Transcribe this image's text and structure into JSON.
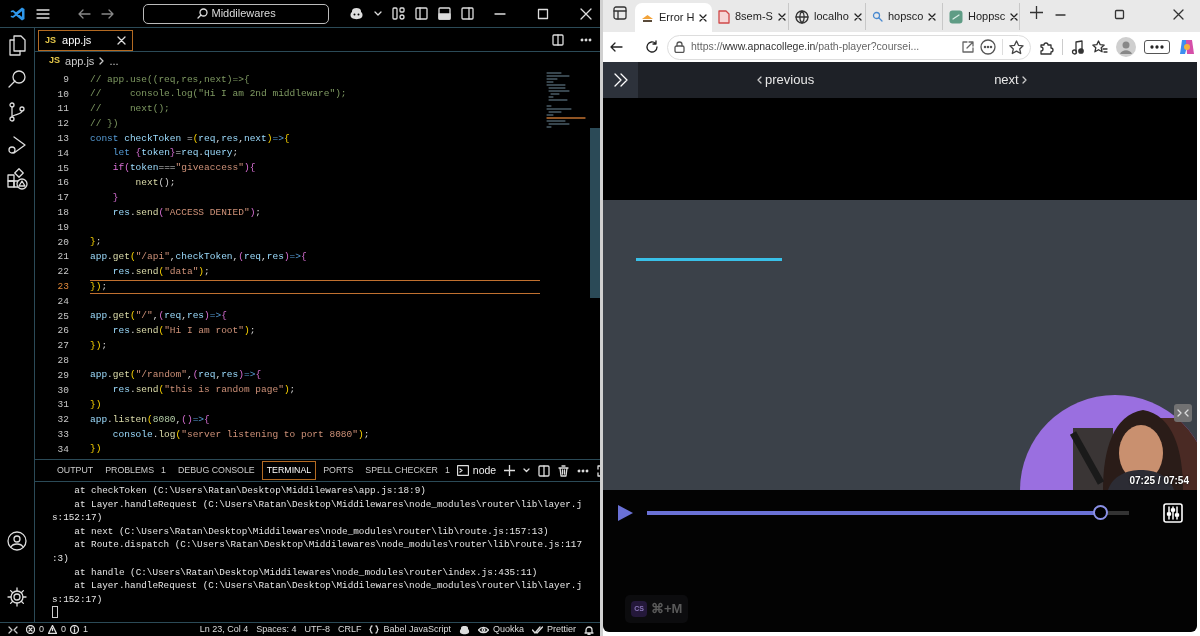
{
  "vscode": {
    "title_search": "Middilewares",
    "editor_tab": {
      "icon": "JS",
      "label": "app.js",
      "selected": true
    },
    "breadcrumb": {
      "icon": "JS",
      "file": "app.js",
      "more": "..."
    },
    "code_lines": [
      {
        "n": "9",
        "current": false,
        "tokens": [
          {
            "text": "// app.use((req,res,next)=>{",
            "kind": "c"
          }
        ]
      },
      {
        "n": "10",
        "current": false,
        "tokens": [
          {
            "text": "//     console.log(\"Hi I am 2nd middleware\");",
            "kind": "c"
          }
        ]
      },
      {
        "n": "11",
        "current": false,
        "tokens": [
          {
            "text": "//     next();",
            "kind": "c"
          }
        ]
      },
      {
        "n": "12",
        "current": false,
        "tokens": [
          {
            "text": "// })",
            "kind": "c"
          }
        ]
      },
      {
        "n": "13",
        "current": false,
        "tokens": [
          {
            "text": "const",
            "kind": "k"
          },
          {
            "text": " checkToken ",
            "kind": "v"
          },
          {
            "text": "=",
            "kind": "p"
          },
          {
            "text": "(",
            "kind": "b"
          },
          {
            "text": "req",
            "kind": "v"
          },
          {
            "text": ",",
            "kind": "p"
          },
          {
            "text": "res",
            "kind": "v"
          },
          {
            "text": ",",
            "kind": "p"
          },
          {
            "text": "next",
            "kind": "v"
          },
          {
            "text": ")",
            "kind": "b"
          },
          {
            "text": "=>",
            "kind": "k"
          },
          {
            "text": "{",
            "kind": "b"
          }
        ]
      },
      {
        "n": "14",
        "current": false,
        "tokens": [
          {
            "text": "    let",
            "kind": "k"
          },
          {
            "text": " {",
            "kind": "m"
          },
          {
            "text": "token",
            "kind": "v"
          },
          {
            "text": "}",
            "kind": "m"
          },
          {
            "text": "=",
            "kind": "p"
          },
          {
            "text": "req",
            "kind": "v"
          },
          {
            "text": ".",
            "kind": "p"
          },
          {
            "text": "query",
            "kind": "v"
          },
          {
            "text": ";",
            "kind": "p"
          }
        ]
      },
      {
        "n": "15",
        "current": false,
        "tokens": [
          {
            "text": "    if",
            "kind": "m"
          },
          {
            "text": "(",
            "kind": "m"
          },
          {
            "text": "token",
            "kind": "v"
          },
          {
            "text": "===",
            "kind": "p"
          },
          {
            "text": "\"giveaccess\"",
            "kind": "s"
          },
          {
            "text": ")",
            "kind": "m"
          },
          {
            "text": "{",
            "kind": "m"
          }
        ]
      },
      {
        "n": "16",
        "current": false,
        "tokens": [
          {
            "text": "        next",
            "kind": "f"
          },
          {
            "text": "();",
            "kind": "p"
          }
        ]
      },
      {
        "n": "17",
        "current": false,
        "tokens": [
          {
            "text": "    }",
            "kind": "m"
          }
        ]
      },
      {
        "n": "18",
        "current": false,
        "tokens": [
          {
            "text": "    res",
            "kind": "v"
          },
          {
            "text": ".",
            "kind": "p"
          },
          {
            "text": "send",
            "kind": "f"
          },
          {
            "text": "(",
            "kind": "m"
          },
          {
            "text": "\"ACCESS DENIED\"",
            "kind": "s"
          },
          {
            "text": ")",
            "kind": "m"
          },
          {
            "text": ";",
            "kind": "p"
          }
        ]
      },
      {
        "n": "19",
        "current": false
      },
      {
        "n": "20",
        "current": false,
        "tokens": [
          {
            "text": "}",
            "kind": "b"
          },
          {
            "text": ";",
            "kind": "p"
          }
        ]
      },
      {
        "n": "21",
        "current": false,
        "tokens": [
          {
            "text": "app",
            "kind": "v"
          },
          {
            "text": ".",
            "kind": "p"
          },
          {
            "text": "get",
            "kind": "f"
          },
          {
            "text": "(",
            "kind": "b"
          },
          {
            "text": "\"/api\"",
            "kind": "s"
          },
          {
            "text": ",",
            "kind": "p"
          },
          {
            "text": "checkToken",
            "kind": "v"
          },
          {
            "text": ",",
            "kind": "p"
          },
          {
            "text": "(",
            "kind": "m"
          },
          {
            "text": "req",
            "kind": "v"
          },
          {
            "text": ",",
            "kind": "p"
          },
          {
            "text": "res",
            "kind": "v"
          },
          {
            "text": ")",
            "kind": "m"
          },
          {
            "text": "=>",
            "kind": "k"
          },
          {
            "text": "{",
            "kind": "m"
          }
        ]
      },
      {
        "n": "22",
        "current": false,
        "tokens": [
          {
            "text": "    res",
            "kind": "v"
          },
          {
            "text": ".",
            "kind": "p"
          },
          {
            "text": "send",
            "kind": "f"
          },
          {
            "text": "(",
            "kind": "b"
          },
          {
            "text": "\"data\"",
            "kind": "s"
          },
          {
            "text": ")",
            "kind": "b"
          },
          {
            "text": ";",
            "kind": "p"
          }
        ]
      },
      {
        "n": "23",
        "current": true,
        "tokens": [
          {
            "text": "})",
            "kind": "b"
          },
          {
            "text": ";",
            "kind": "p"
          }
        ]
      },
      {
        "n": "24",
        "current": false
      },
      {
        "n": "25",
        "current": false,
        "tokens": [
          {
            "text": "app",
            "kind": "v"
          },
          {
            "text": ".",
            "kind": "p"
          },
          {
            "text": "get",
            "kind": "f"
          },
          {
            "text": "(",
            "kind": "b"
          },
          {
            "text": "\"/\"",
            "kind": "s"
          },
          {
            "text": ",",
            "kind": "p"
          },
          {
            "text": "(",
            "kind": "m"
          },
          {
            "text": "req",
            "kind": "v"
          },
          {
            "text": ",",
            "kind": "p"
          },
          {
            "text": "res",
            "kind": "v"
          },
          {
            "text": ")",
            "kind": "m"
          },
          {
            "text": "=>",
            "kind": "k"
          },
          {
            "text": "{",
            "kind": "m"
          }
        ]
      },
      {
        "n": "26",
        "current": false,
        "tokens": [
          {
            "text": "    res",
            "kind": "v"
          },
          {
            "text": ".",
            "kind": "p"
          },
          {
            "text": "send",
            "kind": "f"
          },
          {
            "text": "(",
            "kind": "b"
          },
          {
            "text": "\"Hi I am root\"",
            "kind": "s"
          },
          {
            "text": ")",
            "kind": "b"
          },
          {
            "text": ";",
            "kind": "p"
          }
        ]
      },
      {
        "n": "27",
        "current": false,
        "tokens": [
          {
            "text": "})",
            "kind": "b"
          },
          {
            "text": ";",
            "kind": "p"
          }
        ]
      },
      {
        "n": "28",
        "current": false
      },
      {
        "n": "29",
        "current": false,
        "tokens": [
          {
            "text": "app",
            "kind": "v"
          },
          {
            "text": ".",
            "kind": "p"
          },
          {
            "text": "get",
            "kind": "f"
          },
          {
            "text": "(",
            "kind": "b"
          },
          {
            "text": "\"/random\"",
            "kind": "s"
          },
          {
            "text": ",",
            "kind": "p"
          },
          {
            "text": "(",
            "kind": "m"
          },
          {
            "text": "req",
            "kind": "v"
          },
          {
            "text": ",",
            "kind": "p"
          },
          {
            "text": "res",
            "kind": "v"
          },
          {
            "text": ")",
            "kind": "m"
          },
          {
            "text": "=>",
            "kind": "k"
          },
          {
            "text": "{",
            "kind": "m"
          }
        ]
      },
      {
        "n": "30",
        "current": false,
        "tokens": [
          {
            "text": "    res",
            "kind": "v"
          },
          {
            "text": ".",
            "kind": "p"
          },
          {
            "text": "send",
            "kind": "f"
          },
          {
            "text": "(",
            "kind": "b"
          },
          {
            "text": "\"this is random page\"",
            "kind": "s"
          },
          {
            "text": ")",
            "kind": "b"
          },
          {
            "text": ";",
            "kind": "p"
          }
        ]
      },
      {
        "n": "31",
        "current": false,
        "tokens": [
          {
            "text": "})",
            "kind": "b"
          }
        ]
      },
      {
        "n": "32",
        "current": false,
        "tokens": [
          {
            "text": "app",
            "kind": "v"
          },
          {
            "text": ".",
            "kind": "p"
          },
          {
            "text": "listen",
            "kind": "f"
          },
          {
            "text": "(",
            "kind": "b"
          },
          {
            "text": "8080",
            "kind": "n"
          },
          {
            "text": ",",
            "kind": "p"
          },
          {
            "text": "()",
            "kind": "m"
          },
          {
            "text": "=>",
            "kind": "k"
          },
          {
            "text": "{",
            "kind": "m"
          }
        ]
      },
      {
        "n": "33",
        "current": false,
        "tokens": [
          {
            "text": "    console",
            "kind": "v"
          },
          {
            "text": ".",
            "kind": "p"
          },
          {
            "text": "log",
            "kind": "f"
          },
          {
            "text": "(",
            "kind": "b"
          },
          {
            "text": "\"server listening to port 8080\"",
            "kind": "s"
          },
          {
            "text": ")",
            "kind": "b"
          },
          {
            "text": ";",
            "kind": "p"
          }
        ]
      },
      {
        "n": "34",
        "current": false,
        "tokens": [
          {
            "text": "})",
            "kind": "b"
          }
        ]
      }
    ],
    "panel_tabs": [
      {
        "label": "OUTPUT",
        "selected": false
      },
      {
        "label": "PROBLEMS",
        "count": "1",
        "selected": false
      },
      {
        "label": "DEBUG CONSOLE",
        "selected": false
      },
      {
        "label": "TERMINAL",
        "selected": true
      },
      {
        "label": "PORTS",
        "selected": false
      },
      {
        "label": "SPELL CHECKER",
        "count": "1",
        "selected": false
      }
    ],
    "terminal_name": "node",
    "terminal_lines": [
      "    at checkToken (C:\\Users\\Ratan\\Desktop\\Middilewares\\app.js:18:9)",
      "    at Layer.handleRequest (C:\\Users\\Ratan\\Desktop\\Middilewares\\node_modules\\router\\lib\\layer.j",
      "s:152:17)",
      "    at next (C:\\Users\\Ratan\\Desktop\\Middilewares\\node_modules\\router\\lib\\route.js:157:13)",
      "    at Route.dispatch (C:\\Users\\Ratan\\Desktop\\Middilewares\\node_modules\\router\\lib\\route.js:117",
      ":3)",
      "    at handle (C:\\Users\\Ratan\\Desktop\\Middilewares\\node_modules\\router\\index.js:435:11)",
      "    at Layer.handleRequest (C:\\Users\\Ratan\\Desktop\\Middilewares\\node_modules\\router\\lib\\layer.j",
      "s:152:17)"
    ],
    "status_bar": {
      "errors": "0",
      "warnings": "0",
      "infos": "1",
      "position": "Ln 23, Col 4",
      "indent": "Spaces: 4",
      "encoding": "UTF-8",
      "eol": "CRLF",
      "language": "Babel JavaScript",
      "quokka": "Quokka",
      "prettier": "Prettier"
    }
  },
  "browser": {
    "tabs": [
      {
        "label": "Error H",
        "kind": "cap",
        "selected": true
      },
      {
        "label": "8sem-S",
        "kind": "pdf",
        "selected": false
      },
      {
        "label": "localho",
        "kind": "globe",
        "selected": false
      },
      {
        "label": "hopsco",
        "kind": "search",
        "selected": false
      },
      {
        "label": "Hoppsc",
        "kind": "app",
        "selected": false
      }
    ],
    "url": {
      "scheme": "https://",
      "host": "www.apnacollege.in",
      "path": "/path-player?coursei..."
    },
    "page": {
      "previous": "previous",
      "next": "next",
      "video": {
        "kind": "picture",
        "time": "07:25 / 07:54",
        "level": 0.94
      },
      "shortcut": {
        "icon": "CS",
        "keys": "⌘+M"
      }
    }
  }
}
